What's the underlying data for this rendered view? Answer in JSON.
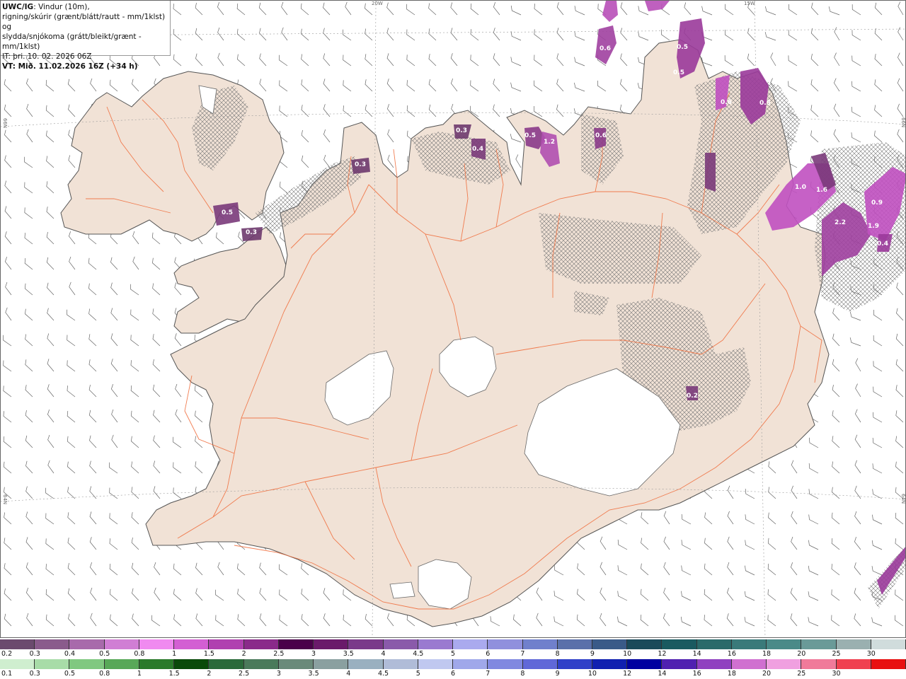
{
  "header": {
    "model": "UWC/IG",
    "line1_rest": ": Vindur (10m),",
    "line2": "rigning/skúrir (grænt/blátt/rautt - mm/1klst) og",
    "line3": "slydda/snjókoma (grátt/bleikt/grænt - mm/1klst)",
    "line4": "IT: þri. 10. 02. 2026 06Z",
    "line5": "VT: Mið. 11.02.2026 16Z (+34 h)"
  },
  "graticule": {
    "lon_top_20w": "20W",
    "lon_top_15w": "15W",
    "lat_left_66n": "66N",
    "lat_left_64n": "64N",
    "lat_right_66n": "66N",
    "lat_right_64n": "64N"
  },
  "precip_labels": [
    "0.6",
    "0.5",
    "0.5",
    "0.3",
    "0.4",
    "0.5",
    "1.2",
    "0.6",
    "0.3",
    "0.5",
    "0.3",
    "0.6",
    "0.5",
    "1.0",
    "1.6",
    "2.2",
    "0.9",
    "1.9",
    "0.4",
    "0.2"
  ],
  "colorbar_snow": {
    "labels": [
      "0.2",
      "0.3",
      "0.4",
      "0.5",
      "0.8",
      "1",
      "1.5",
      "2",
      "2.5",
      "3",
      "3.5",
      "4",
      "4.5",
      "5",
      "6",
      "7",
      "8",
      "9",
      "10",
      "12",
      "14",
      "16",
      "18",
      "20",
      "25",
      "30"
    ],
    "colors": [
      "#6b4a6e",
      "#8a5b8c",
      "#a86aab",
      "#d07ed4",
      "#f08af0",
      "#d35fd3",
      "#b040b0",
      "#8a2a8a",
      "#4a004a",
      "#6a1a6a",
      "#7a3a8a",
      "#8a5aaa",
      "#9a7ad0",
      "#aaaaee",
      "#9090dd",
      "#7080cc",
      "#5a70aa",
      "#3a5a88",
      "#1a4a5a",
      "#1a5a60",
      "#2a6a6a",
      "#3a7a7a",
      "#4a8a88",
      "#6a9a98",
      "#9ab0b0",
      "#d0dcdc"
    ]
  },
  "colorbar_rain": {
    "labels": [
      "0.1",
      "0.3",
      "0.5",
      "0.8",
      "1",
      "1.5",
      "2",
      "2.5",
      "3",
      "3.5",
      "4",
      "4.5",
      "5",
      "6",
      "7",
      "8",
      "9",
      "10",
      "12",
      "14",
      "16",
      "18",
      "20",
      "25",
      "30"
    ],
    "colors": [
      "#cfeecf",
      "#a8dca8",
      "#80c880",
      "#58a858",
      "#2a7a2a",
      "#0a4a0a",
      "#2a6a3a",
      "#4a7a5a",
      "#6a8a7a",
      "#8aa0a0",
      "#9ab0c0",
      "#b0bcd8",
      "#c0c8f0",
      "#a0a8ea",
      "#8088e0",
      "#6068d8",
      "#3040c8",
      "#1020b0",
      "#0000a0",
      "#5020b0",
      "#9040c0",
      "#d070d0",
      "#f0a0e0",
      "#f07a9a",
      "#f04050",
      "#e81010"
    ]
  },
  "colors": {
    "land": "#f1e2d6",
    "coast": "#555555",
    "roads": "#f07040",
    "glacier": "#ffffff",
    "hatch": "#777777",
    "barb": "#666666"
  }
}
